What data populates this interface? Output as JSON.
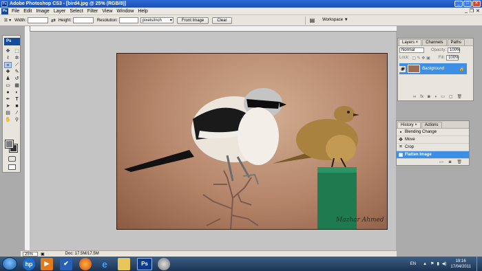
{
  "window": {
    "title": "Adobe Photoshop CS3 - [bird4.jpg @ 25% (RGB/8)]",
    "controls": [
      "_",
      "□",
      "✕"
    ]
  },
  "menu": {
    "items": [
      "File",
      "Edit",
      "Image",
      "Layer",
      "Select",
      "Filter",
      "View",
      "Window",
      "Help"
    ],
    "doc_controls": [
      "_",
      "❐",
      "✕"
    ]
  },
  "options_bar": {
    "width_label": "Width:",
    "width_value": "",
    "height_label": "Height:",
    "height_value": "",
    "resolution_label": "Resolution:",
    "resolution_value": "",
    "units_value": "pixels/inch",
    "front_image_label": "Front Image",
    "clear_label": "Clear",
    "workspace_label": "Workspace ▼"
  },
  "toolbox": {
    "logo": "Ps",
    "tools": [
      "move-icon",
      "marquee-icon",
      "lasso-icon",
      "magic-wand-icon",
      "crop-icon",
      "slice-icon",
      "healing-icon",
      "brush-icon",
      "stamp-icon",
      "history-brush-icon",
      "eraser-icon",
      "gradient-icon",
      "blur-icon",
      "dodge-icon",
      "pen-icon",
      "type-icon",
      "path-select-icon",
      "shape-icon",
      "notes-icon",
      "eyedropper-icon",
      "hand-icon",
      "zoom-icon"
    ],
    "foreground_color": "#7c7c7c",
    "background_color": "#313131"
  },
  "canvas": {
    "signature": "Mazhar Ahmed"
  },
  "status": {
    "zoom": "25%",
    "doc_info": "Doc: 17.5M/17.5M"
  },
  "layers_panel": {
    "tabs": [
      "Layers ×",
      "Channels",
      "Paths"
    ],
    "blend_mode": "Normal",
    "opacity_label": "Opacity:",
    "opacity_value": "100%",
    "lock_label": "Lock:",
    "fill_label": "Fill:",
    "fill_value": "100%",
    "layer_name": "Background"
  },
  "history_panel": {
    "tabs": [
      "History ×",
      "Actions"
    ],
    "items": [
      "Blending Change",
      "Move",
      "Crop",
      "Flatten Image"
    ],
    "selected_index": 3
  },
  "taskbar": {
    "language": "EN",
    "time": "19:16",
    "date": "17/04/2011",
    "apps": [
      "hp-icon",
      "media-player-icon",
      "check-icon",
      "firefox-icon",
      "internet-explorer-icon",
      "folder-icon",
      "photoshop-icon",
      "camera-icon"
    ]
  },
  "colors": {
    "selection_blue": "#3d8ee5",
    "title_blue": "#2d6ad3",
    "panel_gray": "#e7e5de"
  }
}
